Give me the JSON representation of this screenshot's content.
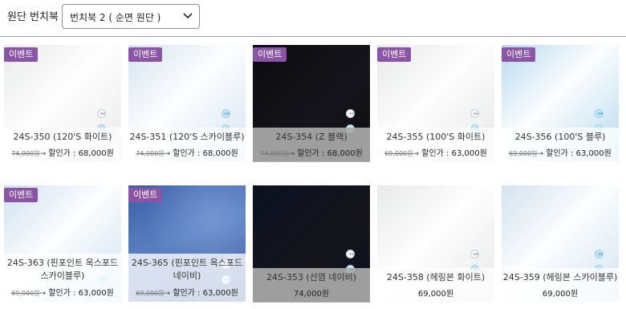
{
  "filter": {
    "label": "원단 번치북 :",
    "selected": "번치북 2 ( 순면 원단 )"
  },
  "products": [
    {
      "badge": "이벤트",
      "name_l1": "24S-350 (120'S 화이트)",
      "name_l2": "",
      "old_price": "74,000원",
      "arrow": "→",
      "discount_label": "할인가 : 68,000원",
      "price_only": "",
      "fabric": "white",
      "color": "#e9eaea"
    },
    {
      "badge": "이벤트",
      "name_l1": "24S-351 (120'S 스카이블루)",
      "name_l2": "",
      "old_price": "74,000원",
      "arrow": "→",
      "discount_label": "할인가 : 68,000원",
      "price_only": "",
      "fabric": "sky-blue",
      "color": "#d6e4f1"
    },
    {
      "badge": "이벤트",
      "name_l1": "24S-354 (Z 블랙)",
      "name_l2": "",
      "old_price": "74,000원",
      "arrow": "→",
      "discount_label": "할인가 : 68,000원",
      "price_only": "",
      "fabric": "black",
      "color": "#0b0b0f"
    },
    {
      "badge": "이벤트",
      "name_l1": "24S-355 (100'S 화이트)",
      "name_l2": "",
      "old_price": "69,000원",
      "arrow": "→",
      "discount_label": "할인가 : 63,000원",
      "price_only": "",
      "fabric": "white",
      "color": "#e6e7e7"
    },
    {
      "badge": "이벤트",
      "name_l1": "24S-356 (100'S 블루)",
      "name_l2": "",
      "old_price": "69,000원",
      "arrow": "→",
      "discount_label": "할인가 : 63,000원",
      "price_only": "",
      "fabric": "blue",
      "color": "#b8d9ee"
    },
    {
      "badge": "이벤트",
      "name_l1": "24S-363 (핀포인트 옥스포드",
      "name_l2": "스카이블루)",
      "old_price": "69,000원",
      "arrow": "→",
      "discount_label": "할인가 : 63,000원",
      "price_only": "",
      "fabric": "sky-blue",
      "color": "#cfe1f2"
    },
    {
      "badge": "이벤트",
      "name_l1": "24S-365 (핀포인트 옥스포드",
      "name_l2": "네이비)",
      "old_price": "69,000원",
      "arrow": "→",
      "discount_label": "할인가 : 63,000원",
      "price_only": "",
      "fabric": "denim",
      "color": "#4f73b6"
    },
    {
      "badge": "",
      "name_l1": "24S-353 (선염 네이비)",
      "name_l2": "",
      "old_price": "",
      "arrow": "",
      "discount_label": "",
      "price_only": "74,000원",
      "fabric": "navy",
      "color": "#0c1122"
    },
    {
      "badge": "",
      "name_l1": "24S-358 (헤링본 화이트)",
      "name_l2": "",
      "old_price": "",
      "arrow": "",
      "discount_label": "",
      "price_only": "69,000원",
      "fabric": "white",
      "color": "#e8e9e9"
    },
    {
      "badge": "",
      "name_l1": "24S-359 (헤링본 스카이블루)",
      "name_l2": "",
      "old_price": "",
      "arrow": "",
      "discount_label": "",
      "price_only": "69,000원",
      "fabric": "sky-blue",
      "color": "#d3e3f0"
    }
  ]
}
